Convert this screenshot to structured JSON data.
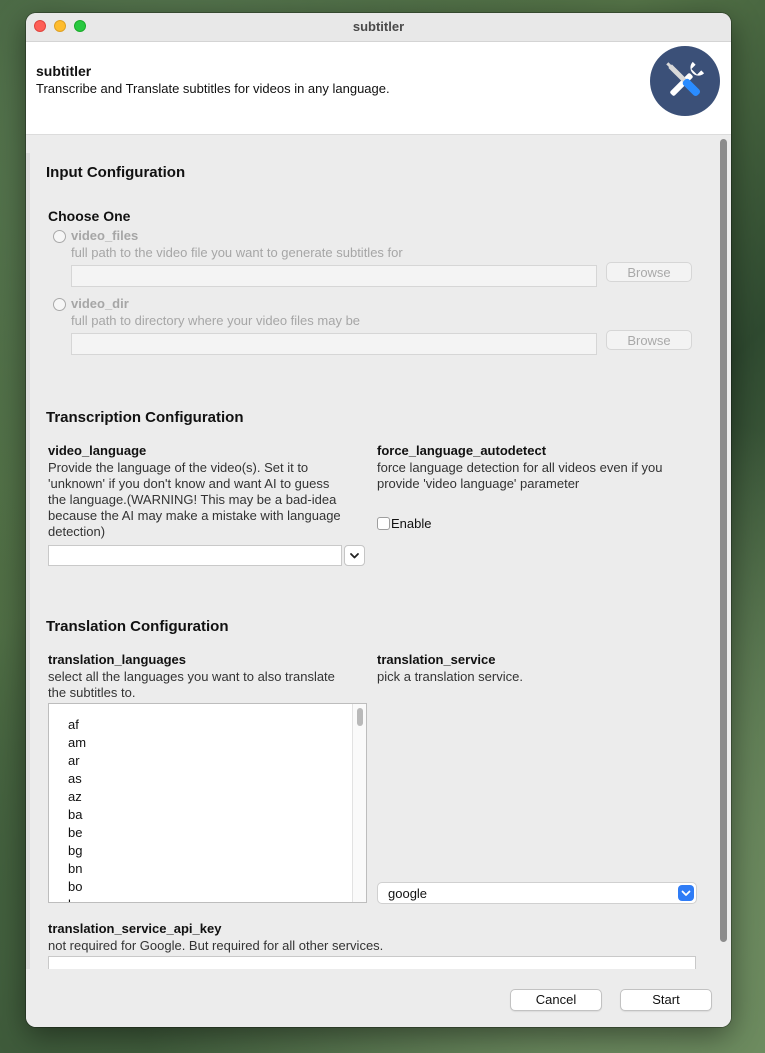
{
  "window": {
    "title": "subtitler"
  },
  "header": {
    "app_name": "subtitler",
    "description": "Transcribe and Translate subtitles for videos in any language."
  },
  "input_config": {
    "title": "Input Configuration",
    "choose_label": "Choose One",
    "video_files": {
      "label": "video_files",
      "help": "full path to the video file you want to generate subtitles for",
      "value": "",
      "browse_label": "Browse"
    },
    "video_dir": {
      "label": "video_dir",
      "help": "full path to directory where your video files may be",
      "value": "",
      "browse_label": "Browse"
    }
  },
  "transcription_config": {
    "title": "Transcription Configuration",
    "video_language": {
      "label": "video_language",
      "help_lines": [
        "Provide the language of the video(s). Set it to",
        "'unknown' if you don't know and want AI to guess",
        "the language.(WARNING! This may be a bad-idea",
        "because the AI may make a mistake with language",
        "detection)"
      ],
      "value": ""
    },
    "force_language_autodetect": {
      "label": "force_language_autodetect",
      "help_lines": [
        "force language detection for all videos even if you",
        "provide 'video language' parameter"
      ],
      "checkbox_label": "Enable",
      "checked": false
    }
  },
  "translation_config": {
    "title": "Translation Configuration",
    "translation_languages": {
      "label": "translation_languages",
      "help_lines": [
        "select all the languages you want to also translate",
        "the subtitles to."
      ],
      "items": [
        "af",
        "am",
        "ar",
        "as",
        "az",
        "ba",
        "be",
        "bg",
        "bn",
        "bo",
        "br"
      ]
    },
    "translation_service": {
      "label": "translation_service",
      "help": "pick a translation service.",
      "selected": "google"
    },
    "api_key": {
      "label": "translation_service_api_key",
      "help": "not required for Google. But required for all other services.",
      "value": ""
    }
  },
  "footer": {
    "cancel_label": "Cancel",
    "start_label": "Start"
  },
  "icons": {
    "app_logo": "tools-icon",
    "dropdown": "chevron-down-icon"
  },
  "colors": {
    "accent": "#2f7cf6",
    "logo_bg": "#3b5078"
  }
}
